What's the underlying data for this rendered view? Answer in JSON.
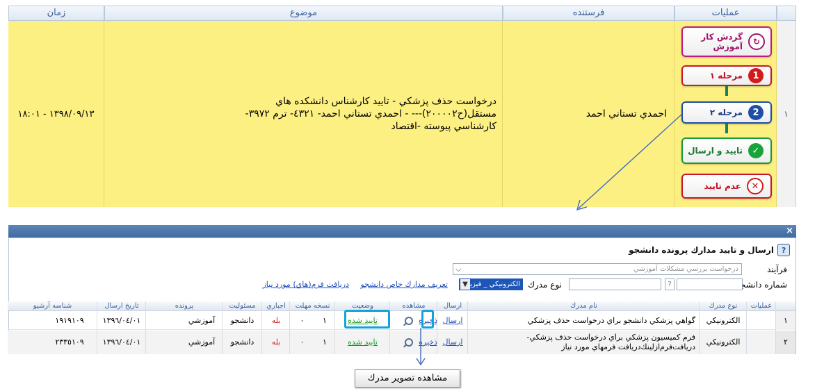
{
  "top_table": {
    "headers": {
      "ops": "عمليات",
      "sender": "فرستنده",
      "subject": "موضوع",
      "time": "زمان"
    },
    "row": {
      "num": "١",
      "sender": "احمدي تستاني احمد",
      "subject": "درخواست حذف پزشكي - تاييد كارشناس دانشكده هاي مستقل(ح٢٠٠٠٠٢)--- - احمدي تستاني احمد- ٤٣٢١- ترم ٣٩٧٢-كارشناسي پيوسته -اقتصاد",
      "time": "١٣٩٨/٠٩/١٣ - ١٨:٠١"
    },
    "workflow": {
      "cycle": "گردش كار آموزش",
      "step1": "مرحله ١",
      "step1_num": "1",
      "step2": "مرحله ٢",
      "step2_num": "2",
      "approve": "تاييد و ارسال",
      "reject": "عدم تاييد"
    }
  },
  "dialog": {
    "close": "×",
    "title": "ارسال و تاييد مدارك پرونده دانشجو",
    "process_label": "فرآيند",
    "process_value": "درخواست بررسي مشكلات آموزشي",
    "student_no_label": "شماره دانشجو",
    "doc_type_label": "نوع مدرك",
    "doc_type_value": "الكترونيكي _ فيزيكي",
    "link_define": "تعريف مدارك خاص دانشجو",
    "link_forms": "دريافت فرم(هاي) مورد نياز",
    "columns": {
      "ops": "عمليات",
      "doc_kind": "نوع مدرك",
      "doc_name": "نام مدرك",
      "send": "ارسال",
      "view": "مشاهده",
      "status": "وضعيت",
      "copy_deadline": "نسخه مهلت",
      "mandatory": "اجباري",
      "responsibility": "مسئوليت",
      "file": "پرونده",
      "send_date": "تاريخ ارسال",
      "archive_id": "شناسه آرشيو"
    },
    "rows": [
      {
        "num": "١",
        "doc_kind": "الكترونيكي",
        "doc_name": "گواهي پزشكي دانشجو براي درخواست حذف پزشكي",
        "send": "ارسال",
        "save": "ذخيره",
        "status": "تاييد شده",
        "copy": "١",
        "deadline": "٠",
        "mandatory": "بله",
        "responsibility": "دانشجو",
        "file": "آموزشي",
        "send_date": "١٣٩٦/٠٤/٠١",
        "archive_id": "١٩١٩١٠٩"
      },
      {
        "num": "٢",
        "doc_kind": "الكترونيكي",
        "doc_name": "فرم كميسيون پزشكي براي درخواست حذف پزشكي- دريافت‌فرم‌ازلينك‌دريافت فرمهاي مورد نياز",
        "send": "ارسال",
        "save": "ذخيره",
        "status": "تاييد شده",
        "copy": "١",
        "deadline": "٠",
        "mandatory": "بله",
        "responsibility": "دانشجو",
        "file": "آموزشي",
        "send_date": "١٣٩٦/٠٤/٠١",
        "archive_id": "٢٣٣٥١٠٩"
      }
    ]
  },
  "view_doc_button": "مشاهده تصوير مدرك",
  "colors": {
    "row_yellow": "#fcf083",
    "header_blue": "#3a5f99",
    "approved_green": "#169922",
    "highlight": "#12a3db",
    "workflow_red": "#c8162c"
  }
}
